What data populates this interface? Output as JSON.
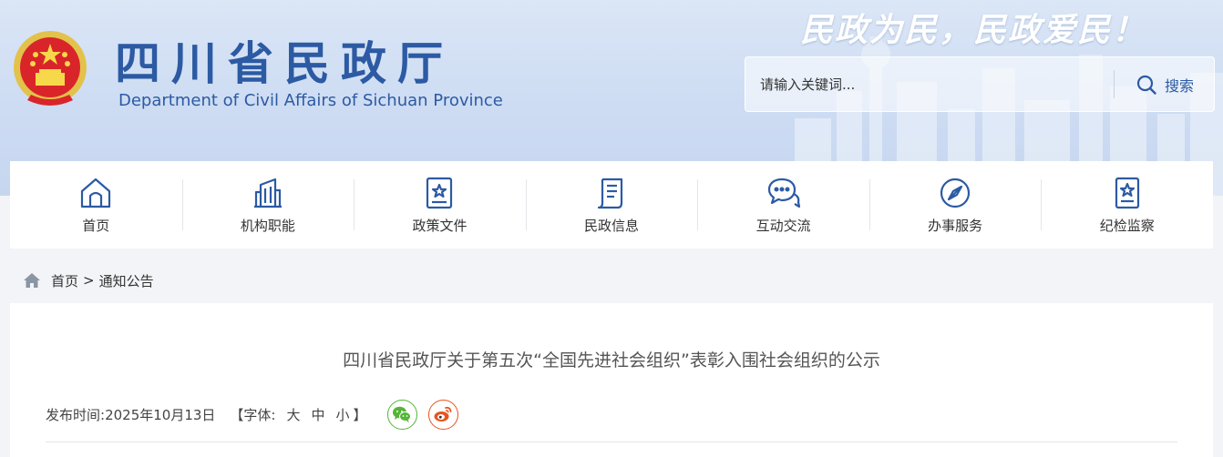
{
  "header": {
    "site_title": "四川省民政厅",
    "site_subtitle": "Department of Civil Affairs of Sichuan Province",
    "slogan": "民政为民，民政爱民！",
    "emblem_icon": "national-emblem-icon",
    "search": {
      "placeholder": "请输入关键词...",
      "value": "",
      "button_label": "搜索",
      "icon": "search-icon"
    }
  },
  "nav": {
    "items": [
      {
        "label": "首页",
        "icon": "home-icon"
      },
      {
        "label": "机构职能",
        "icon": "building-icon"
      },
      {
        "label": "政策文件",
        "icon": "document-star-icon"
      },
      {
        "label": "民政信息",
        "icon": "scroll-icon"
      },
      {
        "label": "互动交流",
        "icon": "chat-bubbles-icon"
      },
      {
        "label": "办事服务",
        "icon": "compass-icon"
      },
      {
        "label": "纪检监察",
        "icon": "badge-star-icon"
      }
    ]
  },
  "breadcrumb": {
    "home": "首页",
    "separator": ">",
    "current": "通知公告",
    "icon": "home-icon"
  },
  "article": {
    "title": "四川省民政厅关于第五次“全国先进社会组织”表彰入围社会组织的公示",
    "publish_label": "发布时间: ",
    "publish_date": "2025年10月13日",
    "font_label": "【字体:",
    "font_sizes": [
      "大",
      "中",
      "小"
    ],
    "font_close": "】",
    "share": [
      {
        "name": "wechat-icon",
        "color": "#54b536"
      },
      {
        "name": "weibo-icon",
        "color": "#e8531f"
      }
    ]
  },
  "colors": {
    "brand_blue": "#2c5aa3",
    "banner_bg": "#d3e0f4",
    "page_bg": "#f2f4f7"
  }
}
